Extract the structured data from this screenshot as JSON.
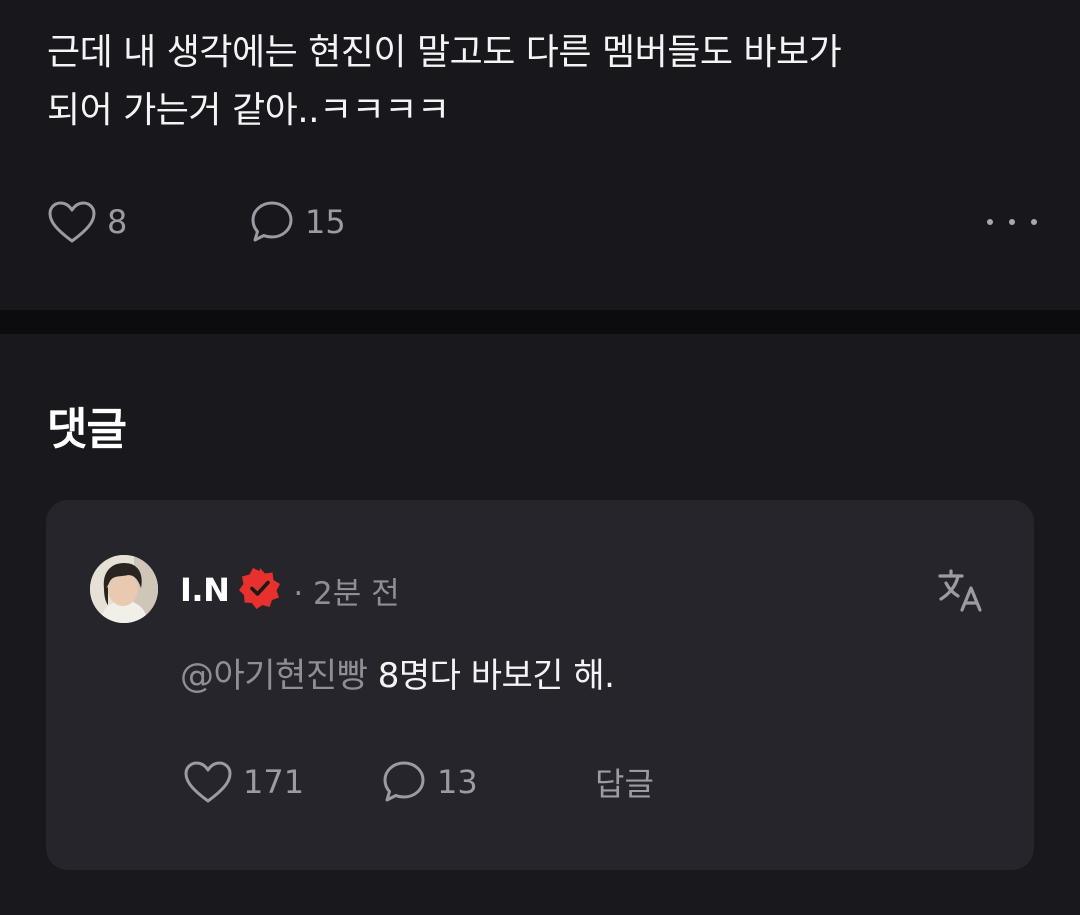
{
  "post": {
    "text": "근데 내 생각에는 현진이 말고도 다른 멤버들도 바보가\n되어 가는거 같아..ㅋㅋㅋㅋ",
    "likes": "8",
    "comments": "15"
  },
  "comments_section": {
    "title": "댓글"
  },
  "comment": {
    "author": "I.N",
    "time": "· 2분 전",
    "mention": "@아기현진빵",
    "text": "8명다 바보긴 해.",
    "likes": "171",
    "replies": "13",
    "reply_label": "답글"
  },
  "colors": {
    "background": "#19181d",
    "card": "#26252b",
    "muted_text": "#9c9ba3",
    "verified_badge": "#e8312c"
  }
}
